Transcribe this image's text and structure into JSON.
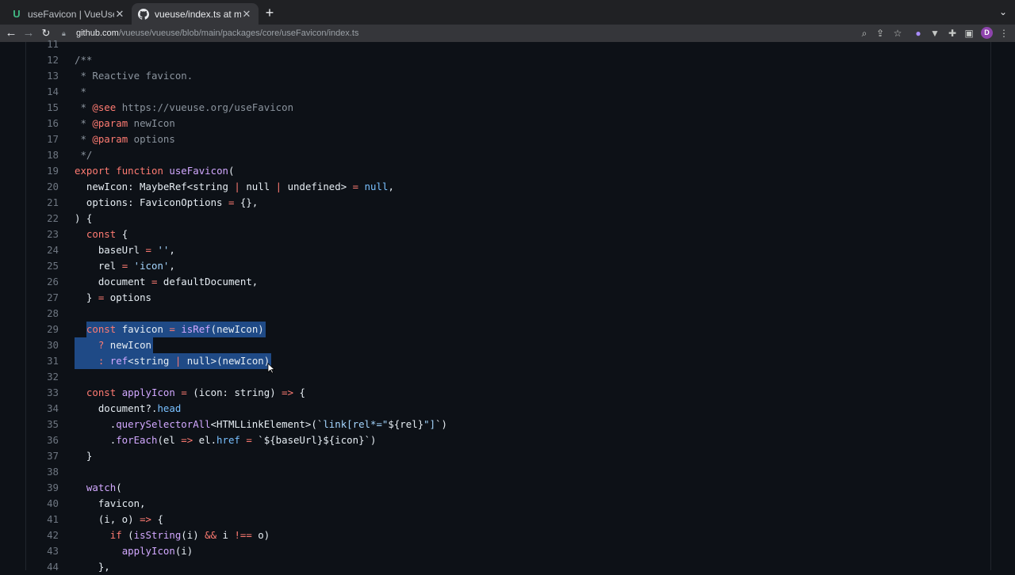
{
  "browser": {
    "tabs": [
      {
        "title": "useFavicon | VueUse",
        "icon": "vueuse-logo-icon",
        "active": false
      },
      {
        "title": "vueuse/index.ts at main · vueuse/vueuse",
        "icon": "github-logo-icon",
        "active": true
      }
    ],
    "url": {
      "host": "github.com",
      "path": "/vueuse/vueuse/blob/main/packages/core/useFavicon/index.ts"
    },
    "avatar_letter": "D",
    "colors": {
      "tab_strip": "#202124",
      "toolbar": "#35363a",
      "avatar": "#8e44ad"
    }
  },
  "code": {
    "first_line_number": 11,
    "selected_lines": [
      29,
      30,
      31
    ],
    "lines": [
      [],
      [
        {
          "t": "/**",
          "c": "c"
        }
      ],
      [
        {
          "t": " * Reactive favicon.",
          "c": "c"
        }
      ],
      [
        {
          "t": " *",
          "c": "c"
        }
      ],
      [
        {
          "t": " * ",
          "c": "c"
        },
        {
          "t": "@see",
          "c": "k"
        },
        {
          "t": " https://vueuse.org/useFavicon",
          "c": "c"
        }
      ],
      [
        {
          "t": " * ",
          "c": "c"
        },
        {
          "t": "@param",
          "c": "k"
        },
        {
          "t": " newIcon",
          "c": "c"
        }
      ],
      [
        {
          "t": " * ",
          "c": "c"
        },
        {
          "t": "@param",
          "c": "k"
        },
        {
          "t": " options",
          "c": "c"
        }
      ],
      [
        {
          "t": " */",
          "c": "c"
        }
      ],
      [
        {
          "t": "export",
          "c": "k"
        },
        {
          "t": " "
        },
        {
          "t": "function",
          "c": "k"
        },
        {
          "t": " "
        },
        {
          "t": "useFavicon",
          "c": "f"
        },
        {
          "t": "("
        }
      ],
      [
        {
          "t": "  newIcon: MaybeRef<string "
        },
        {
          "t": "|",
          "c": "k"
        },
        {
          "t": " null "
        },
        {
          "t": "|",
          "c": "k"
        },
        {
          "t": " undefined> "
        },
        {
          "t": "=",
          "c": "k"
        },
        {
          "t": " "
        },
        {
          "t": "null",
          "c": "n"
        },
        {
          "t": ","
        }
      ],
      [
        {
          "t": "  options: FaviconOptions "
        },
        {
          "t": "=",
          "c": "k"
        },
        {
          "t": " {},"
        }
      ],
      [
        {
          "t": ") {"
        }
      ],
      [
        {
          "t": "  "
        },
        {
          "t": "const",
          "c": "k"
        },
        {
          "t": " {"
        }
      ],
      [
        {
          "t": "    baseUrl "
        },
        {
          "t": "=",
          "c": "k"
        },
        {
          "t": " "
        },
        {
          "t": "''",
          "c": "s"
        },
        {
          "t": ","
        }
      ],
      [
        {
          "t": "    rel "
        },
        {
          "t": "=",
          "c": "k"
        },
        {
          "t": " "
        },
        {
          "t": "'icon'",
          "c": "s"
        },
        {
          "t": ","
        }
      ],
      [
        {
          "t": "    document "
        },
        {
          "t": "=",
          "c": "k"
        },
        {
          "t": " defaultDocument,"
        }
      ],
      [
        {
          "t": "  } "
        },
        {
          "t": "=",
          "c": "k"
        },
        {
          "t": " options"
        }
      ],
      [],
      [
        {
          "t": "  "
        },
        {
          "t": "const",
          "c": "k"
        },
        {
          "t": " favicon "
        },
        {
          "t": "=",
          "c": "k"
        },
        {
          "t": " "
        },
        {
          "t": "isRef",
          "c": "f"
        },
        {
          "t": "(newIcon)"
        }
      ],
      [
        {
          "t": "    "
        },
        {
          "t": "?",
          "c": "k"
        },
        {
          "t": " newIcon"
        }
      ],
      [
        {
          "t": "    "
        },
        {
          "t": ":",
          "c": "k"
        },
        {
          "t": " "
        },
        {
          "t": "ref",
          "c": "f"
        },
        {
          "t": "<string "
        },
        {
          "t": "|",
          "c": "k"
        },
        {
          "t": " null>(newIcon)"
        }
      ],
      [],
      [
        {
          "t": "  "
        },
        {
          "t": "const",
          "c": "k"
        },
        {
          "t": " "
        },
        {
          "t": "applyIcon",
          "c": "f"
        },
        {
          "t": " "
        },
        {
          "t": "=",
          "c": "k"
        },
        {
          "t": " (icon: string) "
        },
        {
          "t": "=>",
          "c": "k"
        },
        {
          "t": " {"
        }
      ],
      [
        {
          "t": "    document?."
        },
        {
          "t": "head",
          "c": "n"
        }
      ],
      [
        {
          "t": "      ."
        },
        {
          "t": "querySelectorAll",
          "c": "f"
        },
        {
          "t": "<HTMLLinkElement>(`"
        },
        {
          "t": "link[rel*=\"",
          "c": "s"
        },
        {
          "t": "${rel}"
        },
        {
          "t": "\"]",
          "c": "s"
        },
        {
          "t": "`)"
        }
      ],
      [
        {
          "t": "      ."
        },
        {
          "t": "forEach",
          "c": "f"
        },
        {
          "t": "(el "
        },
        {
          "t": "=>",
          "c": "k"
        },
        {
          "t": " el."
        },
        {
          "t": "href",
          "c": "n"
        },
        {
          "t": " "
        },
        {
          "t": "=",
          "c": "k"
        },
        {
          "t": " `${baseUrl}${icon}`)"
        }
      ],
      [
        {
          "t": "  }"
        }
      ],
      [],
      [
        {
          "t": "  "
        },
        {
          "t": "watch",
          "c": "f"
        },
        {
          "t": "("
        }
      ],
      [
        {
          "t": "    favicon,"
        }
      ],
      [
        {
          "t": "    (i, o) "
        },
        {
          "t": "=>",
          "c": "k"
        },
        {
          "t": " {"
        }
      ],
      [
        {
          "t": "      "
        },
        {
          "t": "if",
          "c": "k"
        },
        {
          "t": " ("
        },
        {
          "t": "isString",
          "c": "f"
        },
        {
          "t": "(i) "
        },
        {
          "t": "&&",
          "c": "k"
        },
        {
          "t": " i "
        },
        {
          "t": "!==",
          "c": "k"
        },
        {
          "t": " o)"
        }
      ],
      [
        {
          "t": "        "
        },
        {
          "t": "applyIcon",
          "c": "f"
        },
        {
          "t": "(i)"
        }
      ],
      [
        {
          "t": "    },"
        }
      ]
    ]
  }
}
